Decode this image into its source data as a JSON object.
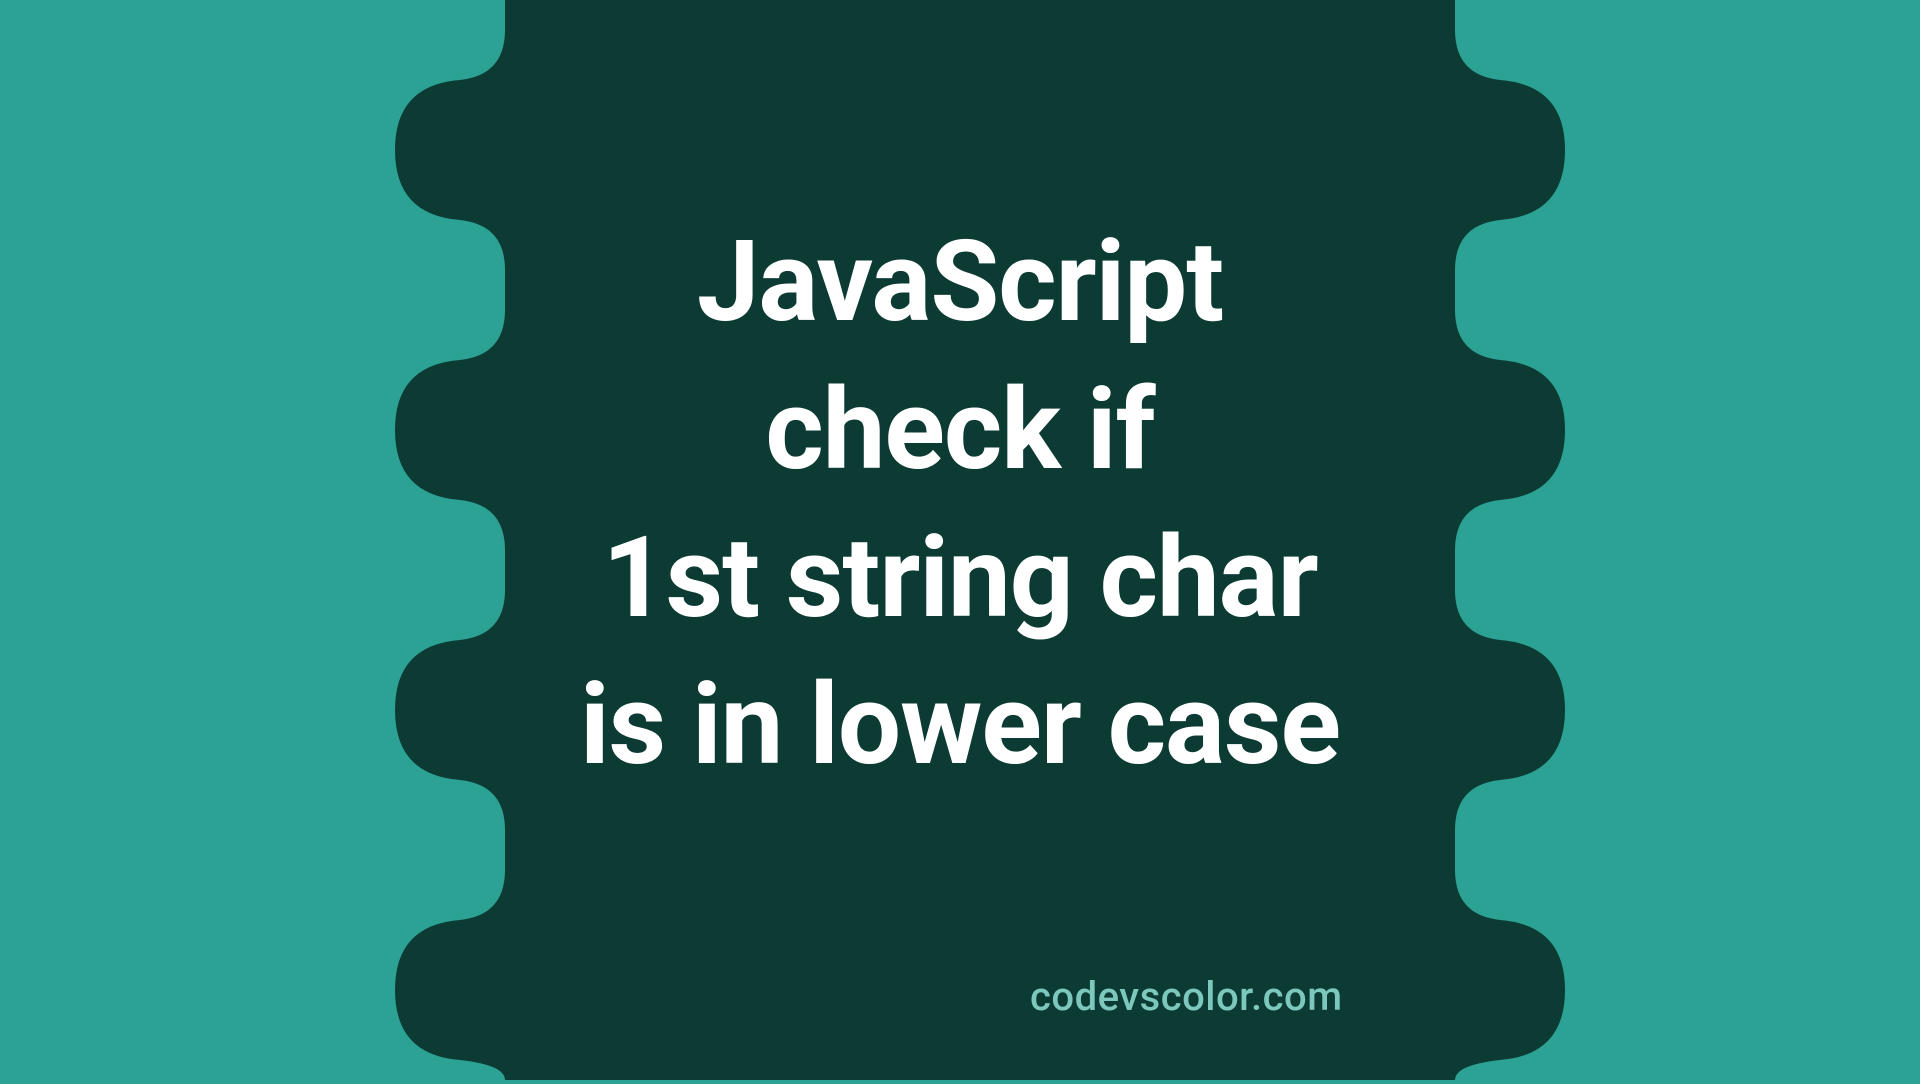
{
  "title": {
    "line1": "JavaScript",
    "line2": "check if",
    "line3": "1st string char",
    "line4": "is in lower case"
  },
  "watermark": "codevscolor.com",
  "colors": {
    "bg_outer": "#2ba293",
    "bg_inner": "#0c3b34",
    "text": "#ffffff",
    "watermark": "#7cc8bc"
  }
}
